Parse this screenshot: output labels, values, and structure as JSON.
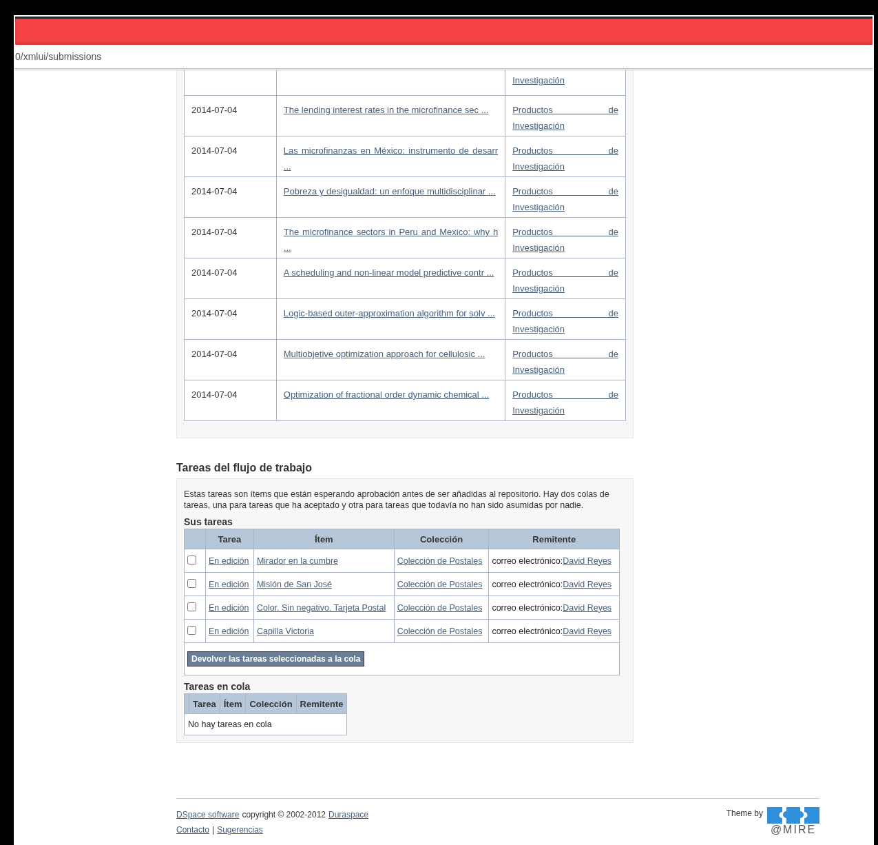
{
  "browser": {
    "address": "0/xmlui/submissions"
  },
  "submissions": {
    "rows": [
      {
        "collection": "Investigación"
      },
      {
        "date": "2014-07-04",
        "title": "The lending interest rates in the microfinance sec ...",
        "collection": "Productos de Investigación"
      },
      {
        "date": "2014-07-04",
        "title": "Las microfinanzas en México: instrumento de desarr ...",
        "collection": "Productos de Investigación"
      },
      {
        "date": "2014-07-04",
        "title": "Pobreza y desigualdad: un enfoque multidisciplinar ...",
        "collection": "Productos de Investigación"
      },
      {
        "date": "2014-07-04",
        "title": "The microfinance sectors in Peru and Mexico: why h ...",
        "collection": "Productos de Investigación"
      },
      {
        "date": "2014-07-04",
        "title": "A scheduling and non-linear model predictive contr ...",
        "collection": "Productos de Investigación"
      },
      {
        "date": "2014-07-04",
        "title": "Logic-based outer-approximation algorithm for solv ...",
        "collection": "Productos de Investigación"
      },
      {
        "date": "2014-07-04",
        "title": "Multiobjetive optimization approach for cellulosic ...",
        "collection": "Productos de Investigación"
      },
      {
        "date": "2014-07-04",
        "title": "Optimization of fractional order dynamic chemical ...",
        "collection": "Productos de Investigación"
      }
    ]
  },
  "workflow": {
    "title": "Tareas del flujo de trabajo",
    "description": "Estas tareas son ítems que están esperando aprobación antes de ser añadidas al repositorio. Hay dos colas de tareas, una para tareas que ha aceptado y otra para tareas que todavía no han sido asumidas por nadie.",
    "own_tasks": {
      "heading": "Sus tareas",
      "columns": [
        "Tarea",
        "Ítem",
        "Colección",
        "Remitente"
      ],
      "rows": [
        {
          "checked": false,
          "task": "En edición",
          "item": "Mirador en la cumbre",
          "collection": "Colección de Postales",
          "submitter_label": "correo electrónico:",
          "submitter": "David Reyes"
        },
        {
          "checked": false,
          "task": "En edición",
          "item": "Misión de San José",
          "collection": "Colección de Postales",
          "submitter_label": "correo electrónico:",
          "submitter": "David Reyes"
        },
        {
          "checked": false,
          "task": "En edición",
          "item": "Color. Sin negativo. Tarjeta Postal",
          "collection": "Colección de Postales",
          "submitter_label": "correo electrónico:",
          "submitter": "David Reyes"
        },
        {
          "checked": false,
          "task": "En edición",
          "item": "Capilla Victoria",
          "collection": "Colección de Postales",
          "submitter_label": "correo electrónico:",
          "submitter": "David Reyes"
        }
      ],
      "button": "Devolver las tareas seleccionadas a la cola"
    },
    "queued_tasks": {
      "heading": "Tareas en cola",
      "columns": [
        "Tarea",
        "Ítem",
        "Colección",
        "Remitente"
      ],
      "empty_message": "No hay tareas en cola"
    }
  },
  "footer": {
    "software_link": "DSpace software",
    "copyright": "copyright © 2002-2012",
    "org_link": "Duraspace",
    "contact_link": "Contacto",
    "separator": "|",
    "feedback_link": "Sugerencias",
    "theme_by": "Theme by",
    "theme_logo_text": "@MIRE"
  }
}
